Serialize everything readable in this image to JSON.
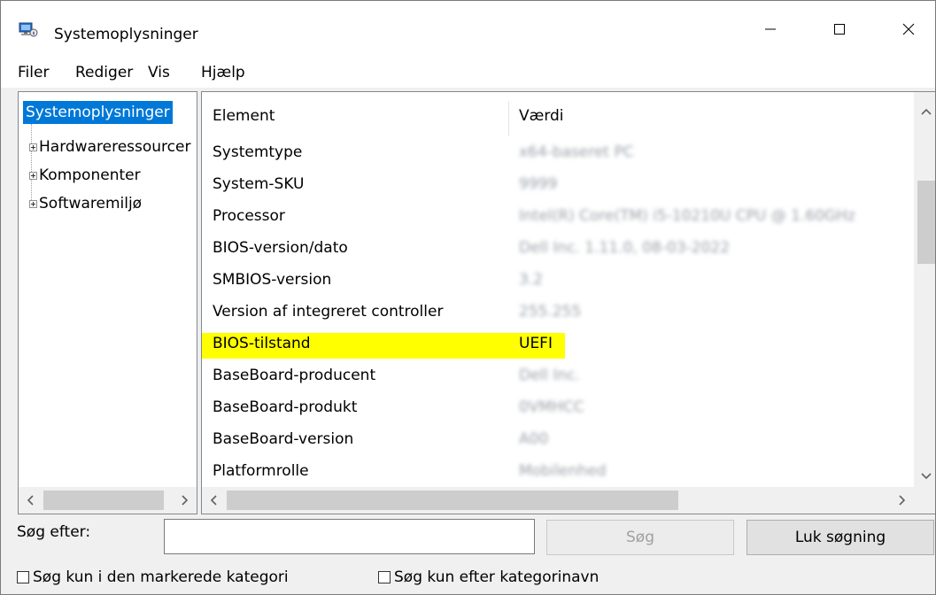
{
  "window": {
    "title": "Systemoplysninger",
    "controls": {
      "minimize": "—",
      "maximize": "☐",
      "close": "✕"
    }
  },
  "menu": {
    "file": "Filer",
    "edit": "Rediger",
    "view": "Vis",
    "help": "Hjælp"
  },
  "tree": {
    "root": "Systemoplysninger",
    "children": [
      "Hardwareressourcer",
      "Komponenter",
      "Softwaremiljø"
    ]
  },
  "list": {
    "headers": {
      "element": "Element",
      "value": "Værdi"
    },
    "rows": [
      {
        "element": "Systemtype",
        "value": "x64-baseret PC",
        "obscured": true
      },
      {
        "element": "System-SKU",
        "value": "9999",
        "obscured": true
      },
      {
        "element": "Processor",
        "value": "Intel(R) Core(TM) i5-10210U CPU @ 1.60GHz",
        "obscured": true
      },
      {
        "element": "BIOS-version/dato",
        "value": "Dell Inc. 1.11.0, 08-03-2022",
        "obscured": true
      },
      {
        "element": "SMBIOS-version",
        "value": "3.2",
        "obscured": true
      },
      {
        "element": "Version af integreret controller",
        "value": "255.255",
        "obscured": true
      },
      {
        "element": "BIOS-tilstand",
        "value": "UEFI",
        "highlighted": true
      },
      {
        "element": "BaseBoard-producent",
        "value": "Dell Inc.",
        "obscured": true
      },
      {
        "element": "BaseBoard-produkt",
        "value": "0VMHCC",
        "obscured": true
      },
      {
        "element": "BaseBoard-version",
        "value": "A00",
        "obscured": true
      },
      {
        "element": "Platformrolle",
        "value": "Mobilenhed",
        "obscured": true
      }
    ]
  },
  "search": {
    "label": "Søg efter:",
    "input_value": "",
    "search_button": "Søg",
    "close_search_button": "Luk søgning",
    "checkbox_selected_category": "Søg kun i den markerede kategori",
    "checkbox_category_names": "Søg kun efter kategorinavn"
  },
  "colors": {
    "selection": "#0078d7",
    "highlight": "#ffff00"
  }
}
